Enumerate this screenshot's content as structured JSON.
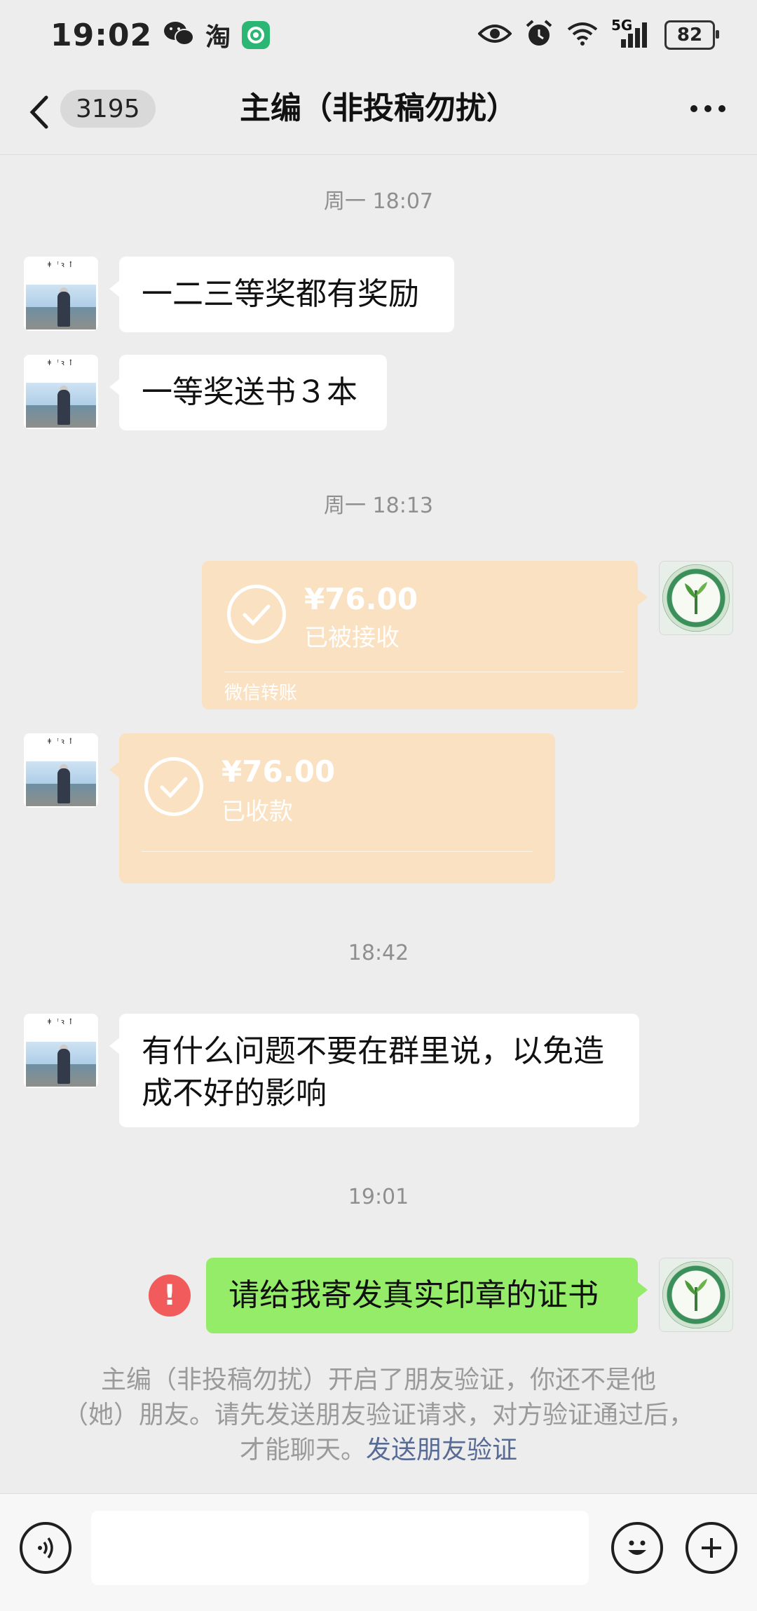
{
  "status_bar": {
    "time": "19:02",
    "taobao_glyph": "淘",
    "network": "5G",
    "battery": "82",
    "icons": [
      "wechat-icon",
      "taobao-icon",
      "app-icon",
      "eye-icon",
      "alarm-icon",
      "wifi-icon",
      "signal-icon",
      "battery-icon"
    ]
  },
  "header": {
    "unread_count": "3195",
    "title": "主编（非投稿勿扰）"
  },
  "messages": [
    {
      "type": "timestamp",
      "text": "周一 18:07"
    },
    {
      "type": "text",
      "side": "left",
      "text": "一二三等奖都有奖励"
    },
    {
      "type": "text",
      "side": "left",
      "text": "一等奖送书３本"
    },
    {
      "type": "timestamp",
      "text": "周一 18:13"
    },
    {
      "type": "transfer",
      "side": "right",
      "amount": "¥76.00",
      "status": "已被接收",
      "caption": "微信转账"
    },
    {
      "type": "transfer",
      "side": "left",
      "amount": "¥76.00",
      "status": "已收款",
      "caption": ""
    },
    {
      "type": "timestamp",
      "text": "18:42"
    },
    {
      "type": "text",
      "side": "left",
      "text_line1": "有什么问题不要在群里说，以免造",
      "text_line2": "成不好的影响"
    },
    {
      "type": "timestamp",
      "text": "19:01"
    },
    {
      "type": "text",
      "side": "right",
      "failed": true,
      "error_glyph": "!",
      "text": "请给我寄发真实印章的证书"
    }
  ],
  "notice": {
    "line1": "主编（非投稿勿扰）开启了朋友验证，你还不是他",
    "line2": "（她）朋友。请先发送朋友验证请求，对方验证通过后，",
    "line3_text": "才能聊天。",
    "link": "发送朋友验证"
  },
  "input_bar": {
    "value": "",
    "placeholder": "",
    "icons": [
      "voice-icon",
      "emoji-icon",
      "plus-icon"
    ]
  },
  "colors": {
    "background": "#ededed",
    "green_bubble": "#95ec69",
    "transfer_card": "#fae1c2",
    "error_red": "#f15b5b",
    "link": "#576b95"
  }
}
